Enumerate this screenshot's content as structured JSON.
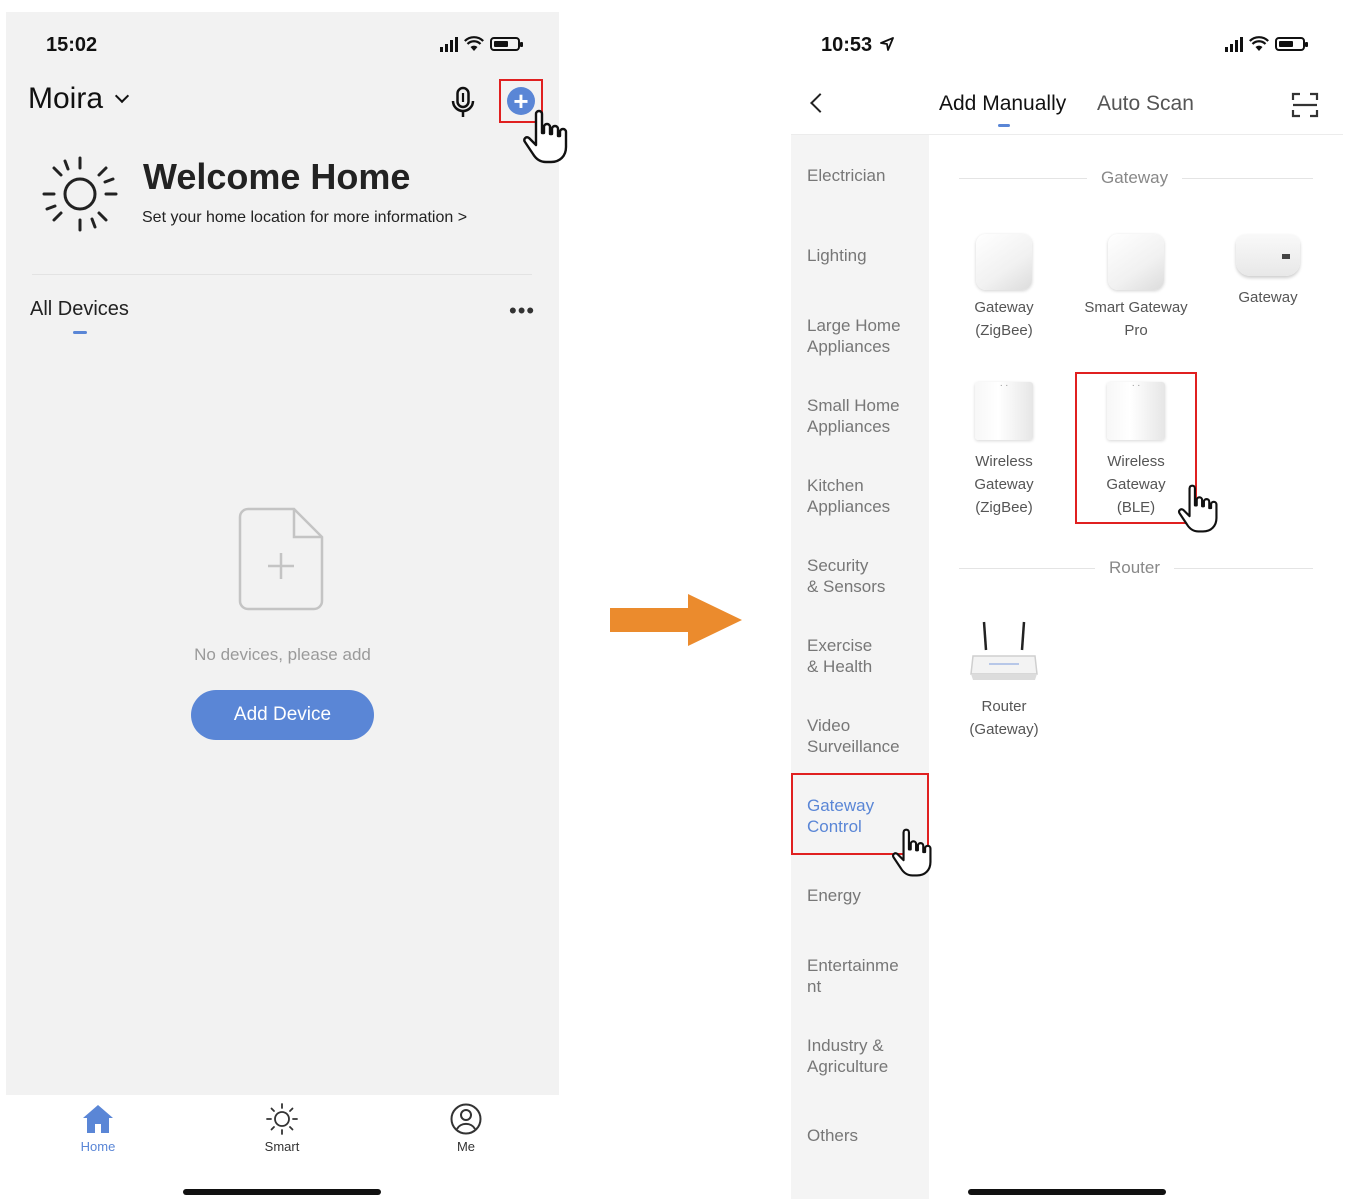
{
  "colors": {
    "accent": "#5a86d6",
    "highlight": "#e02020",
    "arrow": "#eb8b2d"
  },
  "left": {
    "status_time": "15:02",
    "home_name": "Moira",
    "welcome_title": "Welcome Home",
    "welcome_subtitle": "Set your home location for more information  >",
    "all_devices_tab": "All Devices",
    "more": "•••",
    "empty_text": "No devices, please add",
    "add_device": "Add Device",
    "tabs": [
      {
        "label": "Home",
        "icon": "home-icon"
      },
      {
        "label": "Smart",
        "icon": "sun-icon"
      },
      {
        "label": "Me",
        "icon": "profile-icon"
      }
    ]
  },
  "right": {
    "status_time": "10:53",
    "tabs": {
      "add_manually": "Add Manually",
      "auto_scan": "Auto Scan"
    },
    "categories": [
      [
        "Electrician"
      ],
      [
        "Lighting"
      ],
      [
        "Large Home",
        "Appliances"
      ],
      [
        "Small Home",
        "Appliances"
      ],
      [
        "Kitchen",
        "Appliances"
      ],
      [
        "Security",
        "& Sensors"
      ],
      [
        "Exercise",
        "& Health"
      ],
      [
        "Video",
        "Surveillance"
      ],
      [
        "Gateway",
        "Control"
      ],
      [
        "Energy"
      ],
      [
        "Entertainme",
        "nt"
      ],
      [
        "Industry &",
        "Agriculture"
      ],
      [
        "Others"
      ]
    ],
    "section_gateway": "Gateway",
    "section_router": "Router",
    "devices": [
      [
        "Gateway",
        "(ZigBee)"
      ],
      [
        "Smart Gateway",
        "Pro"
      ],
      [
        "Gateway"
      ],
      [
        "Wireless",
        "Gateway",
        "(ZigBee)"
      ],
      [
        "Wireless",
        "Gateway",
        "(BLE)"
      ],
      [
        "Router",
        "(Gateway)"
      ]
    ]
  }
}
